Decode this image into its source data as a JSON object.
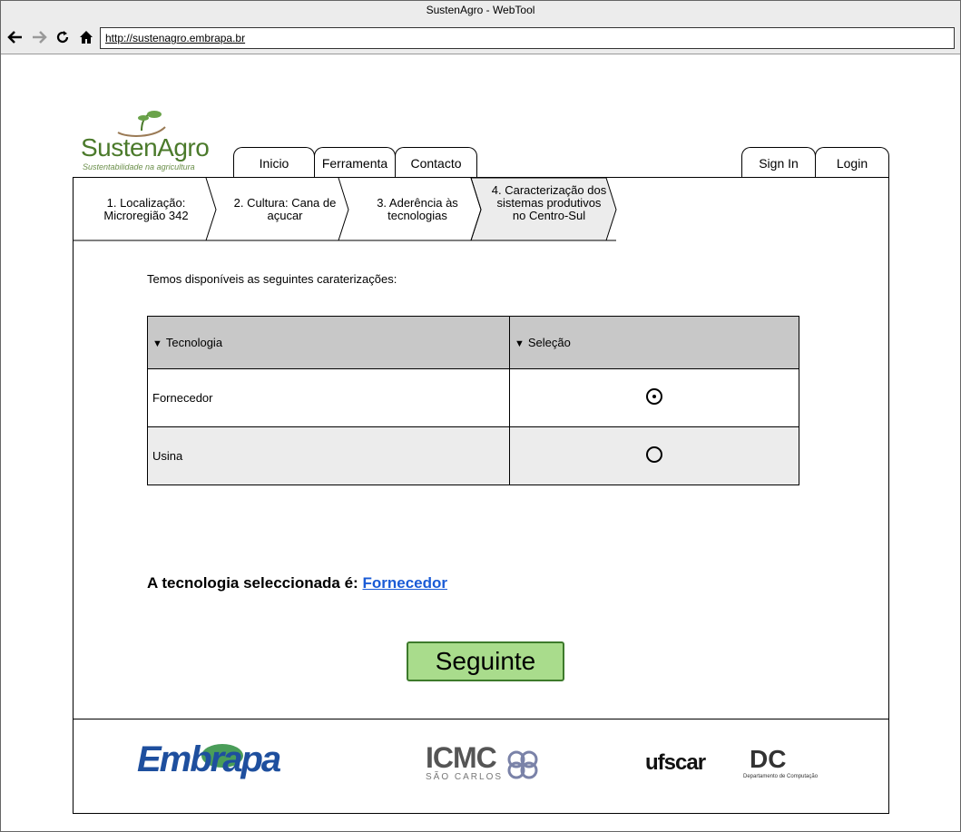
{
  "window": {
    "title": "SustenAgro - WebTool"
  },
  "browser": {
    "url": "http://sustenagro.embrapa.br"
  },
  "logo": {
    "name": "SustenAgro",
    "tagline": "Sustentabilidade na agricultura"
  },
  "nav": {
    "tabs": [
      {
        "label": "Inicio"
      },
      {
        "label": "Ferramenta"
      },
      {
        "label": "Contacto"
      }
    ],
    "sign_in": "Sign In",
    "login": "Login"
  },
  "steps": [
    {
      "label": "1. Localização: Microregião 342",
      "active": false
    },
    {
      "label": "2. Cultura: Cana de açucar",
      "active": false
    },
    {
      "label": "3. Aderência às tecnologias",
      "active": false
    },
    {
      "label": "4. Caracterização dos sistemas produtivos no Centro-Sul",
      "active": true
    }
  ],
  "main": {
    "intro": "Temos disponíveis as seguintes caraterizações:",
    "table": {
      "headers": [
        "Tecnologia",
        "Seleção"
      ],
      "rows": [
        {
          "name": "Fornecedor",
          "selected": true
        },
        {
          "name": "Usina",
          "selected": false
        }
      ]
    },
    "selected_prefix": "A tecnologia seleccionada é:",
    "selected_value": "Fornecedor",
    "next_label": "Seguinte"
  },
  "footer": {
    "logos": [
      {
        "name": "Embrapa"
      },
      {
        "name": "ICMC",
        "sub": "SÃO CARLOS"
      },
      {
        "name": "ufscar"
      },
      {
        "name": "DC",
        "sub": "Departamento de Computação"
      }
    ]
  },
  "colors": {
    "accent_green": "#a9dc8c",
    "link_blue": "#1a5bd6",
    "header_gray": "#c8c8c8",
    "brand_green": "#4b7a2b"
  }
}
